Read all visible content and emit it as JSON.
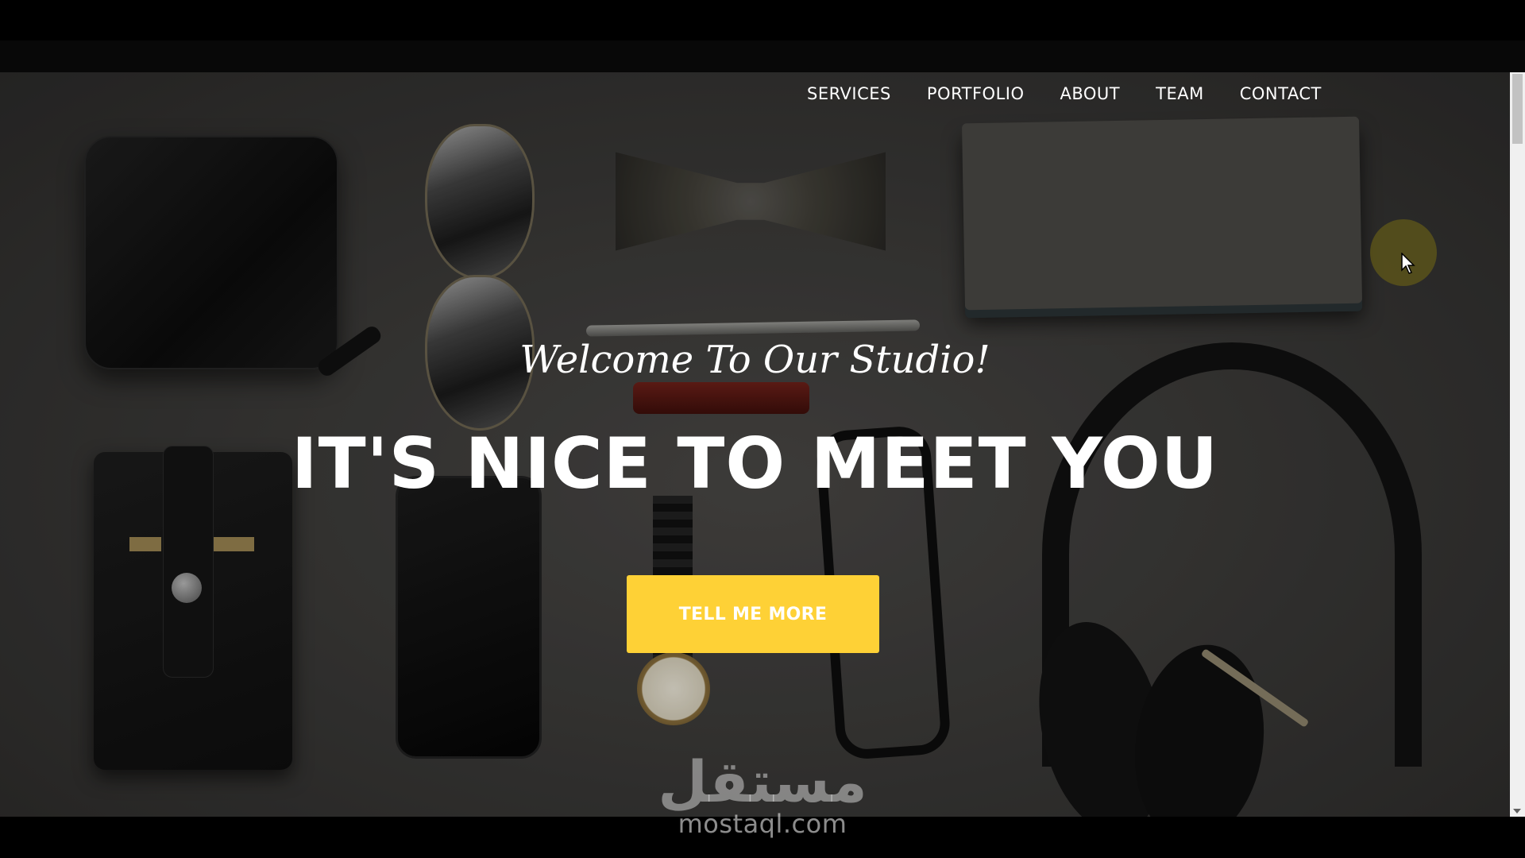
{
  "nav": {
    "items": [
      {
        "label": "SERVICES"
      },
      {
        "label": "PORTFOLIO"
      },
      {
        "label": "ABOUT"
      },
      {
        "label": "TEAM"
      },
      {
        "label": "CONTACT"
      }
    ]
  },
  "hero": {
    "subtitle": "Welcome To Our Studio!",
    "title": "IT'S NICE TO MEET YOU",
    "cta_label": "TELL ME MORE"
  },
  "watermark": {
    "logo": "مستقل",
    "text": "mostaql.com"
  },
  "colors": {
    "accent": "#fed136",
    "text": "#ffffff",
    "background": "#3c3b39"
  },
  "icons": {
    "cursor": "mouse-pointer-icon"
  }
}
